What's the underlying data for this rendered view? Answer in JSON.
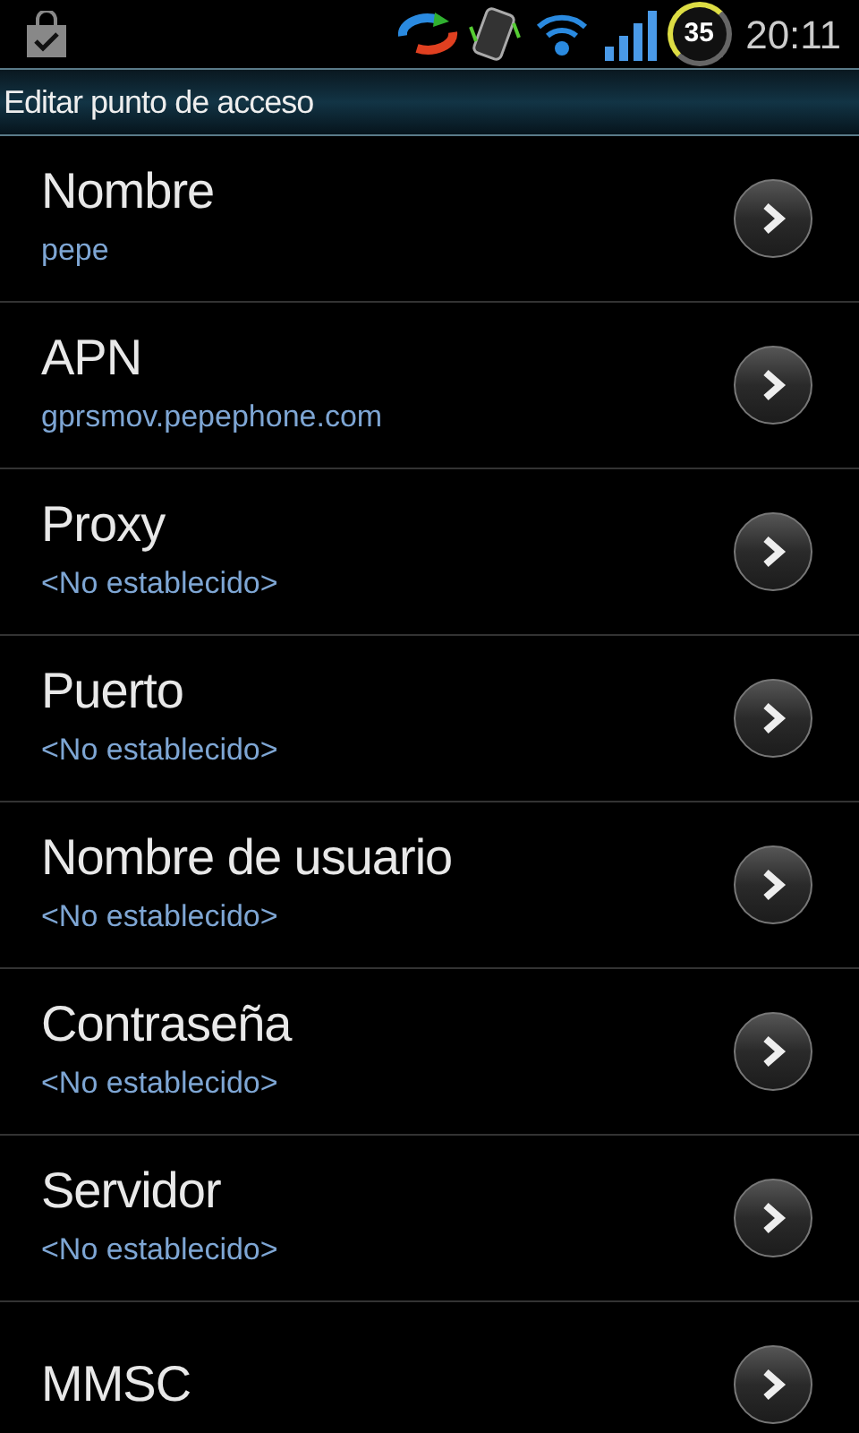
{
  "status_bar": {
    "battery": "35",
    "time": "20:11"
  },
  "title": "Editar punto de acceso",
  "settings": [
    {
      "label": "Nombre",
      "value": "pepe"
    },
    {
      "label": "APN",
      "value": "gprsmov.pepephone.com"
    },
    {
      "label": "Proxy",
      "value": "<No establecido>"
    },
    {
      "label": "Puerto",
      "value": "<No establecido>"
    },
    {
      "label": "Nombre de usuario",
      "value": "<No establecido>"
    },
    {
      "label": "Contraseña",
      "value": "<No establecido>"
    },
    {
      "label": "Servidor",
      "value": "<No establecido>"
    },
    {
      "label": "MMSC"
    }
  ]
}
